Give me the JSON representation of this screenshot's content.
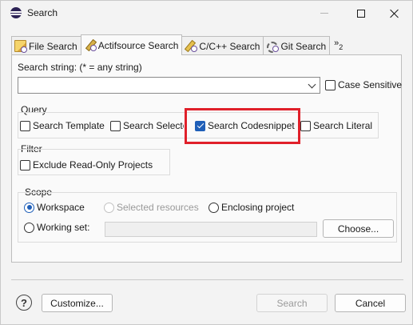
{
  "window": {
    "title": "Search"
  },
  "tabs": [
    {
      "label": "File Search",
      "icon": "file-search-icon",
      "active": false
    },
    {
      "label": "Actifsource Search",
      "icon": "actifsource-search-icon",
      "active": true
    },
    {
      "label": "C/C++ Search",
      "icon": "cpp-search-icon",
      "active": false
    },
    {
      "label": "Git Search",
      "icon": "git-search-icon",
      "active": false
    }
  ],
  "tab_overflow": {
    "label": "»",
    "count": "2"
  },
  "search": {
    "label": "Search string: (* = any string)",
    "value": "",
    "case_sensitive": {
      "label": "Case Sensitive",
      "checked": false
    }
  },
  "query": {
    "title": "Query",
    "options": [
      {
        "label": "Search Template",
        "checked": false
      },
      {
        "label": "Search Selecto",
        "checked": false
      },
      {
        "label": "Search Codesnippet",
        "checked": true
      },
      {
        "label": "Search Literal",
        "checked": false
      }
    ],
    "highlight_color": "#e0202a"
  },
  "filter": {
    "title": "Filter",
    "exclude_readonly": {
      "label": "Exclude Read-Only Projects",
      "checked": false
    }
  },
  "scope": {
    "title": "Scope",
    "workspace": {
      "label": "Workspace",
      "selected": true
    },
    "selected_resources": {
      "label": "Selected resources",
      "enabled": false
    },
    "enclosing_project": {
      "label": "Enclosing project",
      "selected": false
    },
    "working_set": {
      "label": "Working set:",
      "value": "",
      "selected": false
    },
    "choose_label": "Choose..."
  },
  "footer": {
    "help_label": "?",
    "customize_label": "Customize...",
    "search_label": "Search",
    "search_enabled": false,
    "cancel_label": "Cancel"
  },
  "colors": {
    "accent": "#1f5fb8",
    "highlight": "#e0202a"
  }
}
